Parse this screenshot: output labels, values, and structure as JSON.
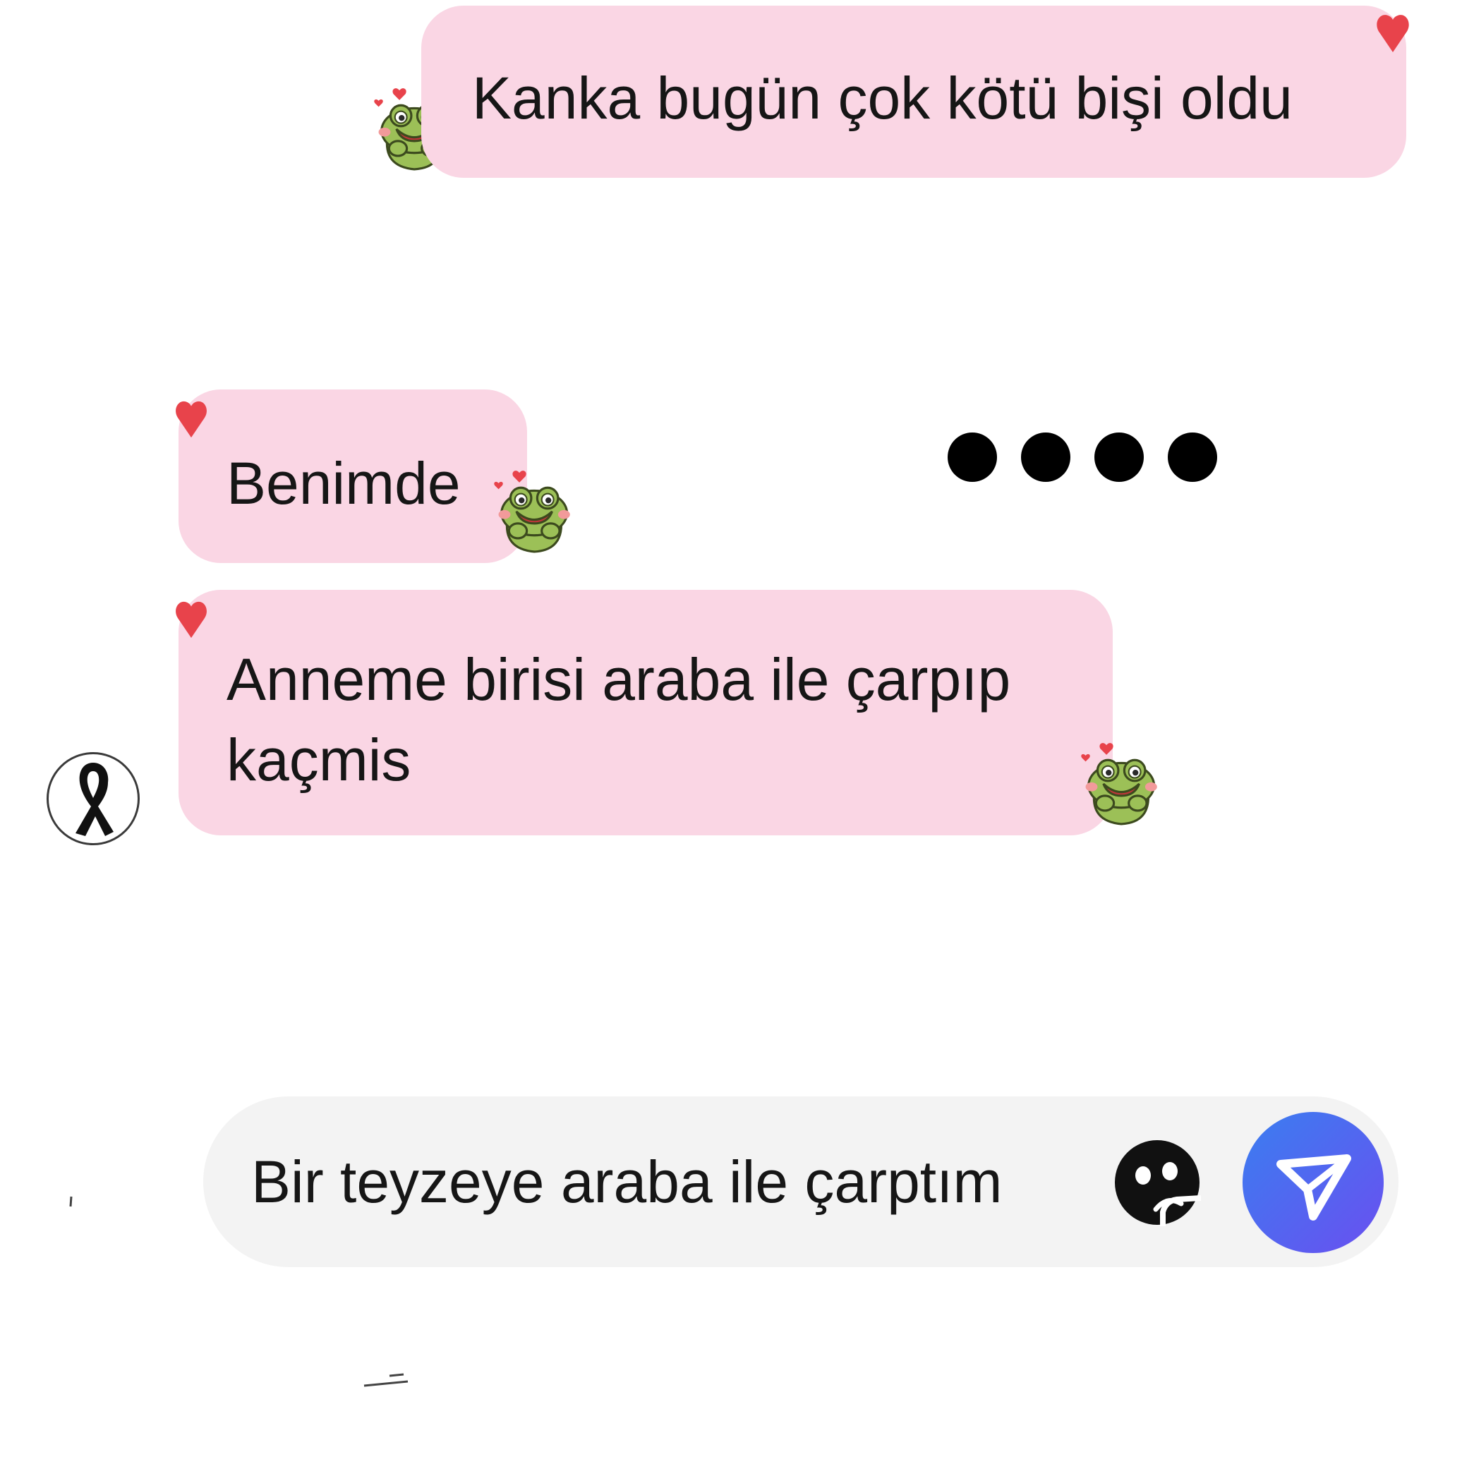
{
  "messages": [
    {
      "id": "msg-1",
      "sender": "self",
      "text": "Kanka bugün çok kötü bişi oldu",
      "reaction": "heart"
    },
    {
      "id": "msg-2",
      "sender": "other",
      "text": "Benimde",
      "reaction": "heart"
    },
    {
      "id": "msg-3",
      "sender": "other",
      "text": "Anneme birisi araba ile çarpıp\nkaçmis",
      "reaction": "heart"
    }
  ],
  "typing_indicator": {
    "dot_count": 4
  },
  "avatar": {
    "icon": "black-ribbon-icon"
  },
  "composer": {
    "draft_text": "Bir teyzeye araba ile çarptım",
    "emoji_icon": "sad-face-sticker-icon",
    "send_icon": "paper-plane-icon"
  },
  "colors": {
    "bubble": "#fad6e4",
    "heart": "#e8434b",
    "composer_bg": "#f3f3f3",
    "send_gradient_start": "#3a7ef0",
    "send_gradient_end": "#6a4ff0"
  }
}
